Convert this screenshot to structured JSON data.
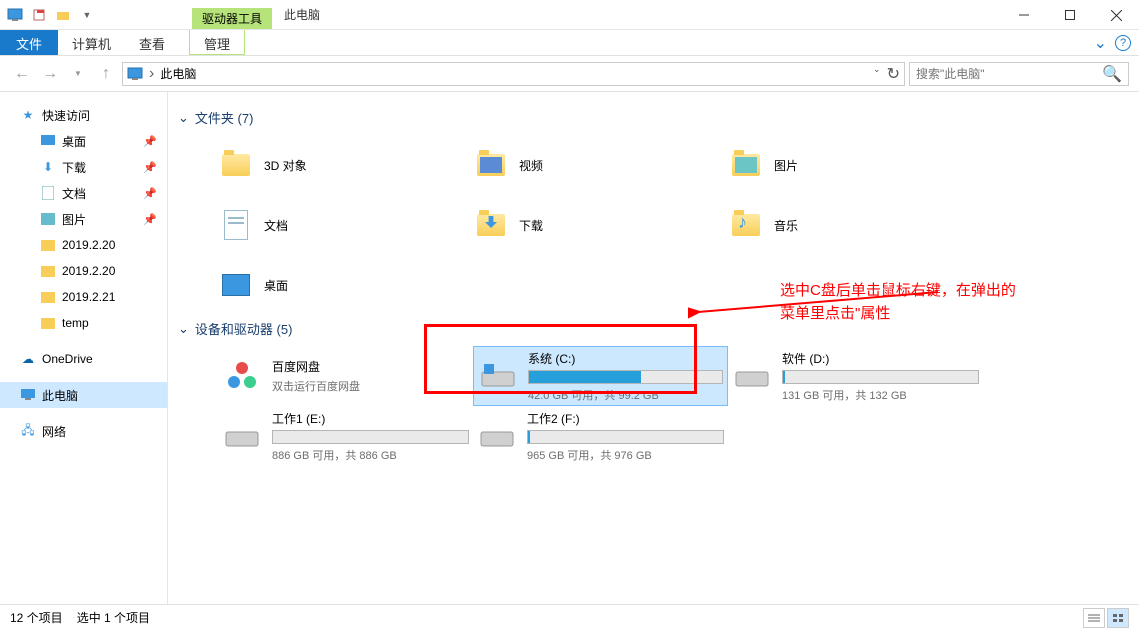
{
  "titlebar": {
    "context_tab": "驱动器工具",
    "title": "此电脑"
  },
  "ribbon": {
    "file": "文件",
    "tabs": [
      "计算机",
      "查看"
    ],
    "context": "管理"
  },
  "nav": {
    "location": "此电脑",
    "search_placeholder": "搜索\"此电脑\""
  },
  "sidebar": {
    "quick_access": "快速访问",
    "items": [
      {
        "label": "桌面",
        "icon": "desktop",
        "pinned": true
      },
      {
        "label": "下载",
        "icon": "download",
        "pinned": true
      },
      {
        "label": "文档",
        "icon": "document",
        "pinned": true
      },
      {
        "label": "图片",
        "icon": "picture",
        "pinned": true
      },
      {
        "label": "2019.2.20",
        "icon": "folder",
        "pinned": false
      },
      {
        "label": "2019.2.20",
        "icon": "folder",
        "pinned": false
      },
      {
        "label": "2019.2.21",
        "icon": "folder",
        "pinned": false
      },
      {
        "label": "temp",
        "icon": "folder",
        "pinned": false
      }
    ],
    "onedrive": "OneDrive",
    "this_pc": "此电脑",
    "network": "网络"
  },
  "sections": {
    "folders_title": "文件夹 (7)",
    "drives_title": "设备和驱动器 (5)"
  },
  "folders": [
    {
      "label": "3D 对象"
    },
    {
      "label": "视频"
    },
    {
      "label": "图片"
    },
    {
      "label": "文档"
    },
    {
      "label": "下载"
    },
    {
      "label": "音乐"
    },
    {
      "label": "桌面"
    }
  ],
  "drives": [
    {
      "name": "百度网盘",
      "sub": "双击运行百度网盘",
      "type": "app",
      "selected": false
    },
    {
      "name": "系统 (C:)",
      "stats": "42.0 GB 可用，共 99.2 GB",
      "fill": 58,
      "type": "os",
      "selected": true
    },
    {
      "name": "软件 (D:)",
      "stats": "131 GB 可用，共 132 GB",
      "fill": 1,
      "type": "hdd",
      "selected": false
    },
    {
      "name": "工作1 (E:)",
      "stats": "886 GB 可用，共 886 GB",
      "fill": 0,
      "type": "hdd",
      "selected": false
    },
    {
      "name": "工作2 (F:)",
      "stats": "965 GB 可用，共 976 GB",
      "fill": 1,
      "type": "hdd",
      "selected": false
    }
  ],
  "annotation": {
    "line1": "选中C盘后单击鼠标右键，在弹出的",
    "line2": "菜单里点击\"属性"
  },
  "status": {
    "count": "12 个项目",
    "selected": "选中 1 个项目"
  }
}
